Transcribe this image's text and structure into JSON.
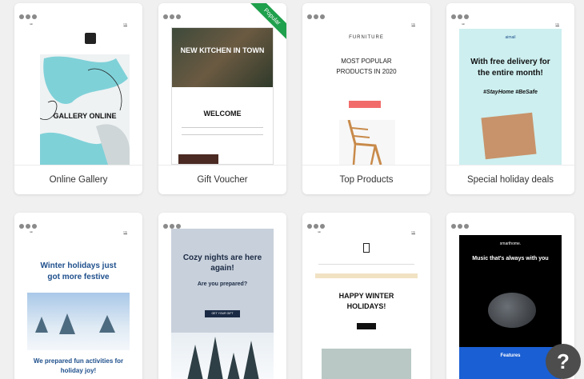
{
  "cards": [
    {
      "label": "Online Gallery",
      "popular": false
    },
    {
      "label": "Gift Voucher",
      "popular": true,
      "ribbon": "Popular"
    },
    {
      "label": "Top Products",
      "popular": false
    },
    {
      "label": "Special holiday deals",
      "popular": false
    }
  ],
  "previews": {
    "gallery": {
      "title": "GALLERY ONLINE"
    },
    "voucher": {
      "hero": "NEW KITCHEN IN TOWN",
      "welcome": "WELCOME"
    },
    "products": {
      "brand": "FURNITURE",
      "headline": "MOST POPULAR PRODUCTS IN 2020"
    },
    "holiday": {
      "brand": "aimail",
      "headline": "With free delivery for the entire month!",
      "tags": "#StayHome #BeSafe"
    },
    "winter": {
      "headline": "Winter holidays just got more festive",
      "footer": "We prepared fun activities for holiday joy!"
    },
    "cozy": {
      "headline": "Cozy nights are here again!",
      "sub": "Are you prepared?",
      "cta": "GET YOUR GIFT"
    },
    "happy": {
      "headline": "HAPPY WINTER HOLIDAYS!"
    },
    "music": {
      "brand": "smarthome.",
      "headline": "Music that's always with you",
      "features": "Features"
    }
  },
  "help": {
    "label": "?"
  },
  "colors": {
    "ribbon": "#1fa04c",
    "teal": "#7fd1d8",
    "blue_header": "#1e4f8c",
    "music_blue": "#1a5fd3",
    "salmon": "#f26b6b"
  }
}
